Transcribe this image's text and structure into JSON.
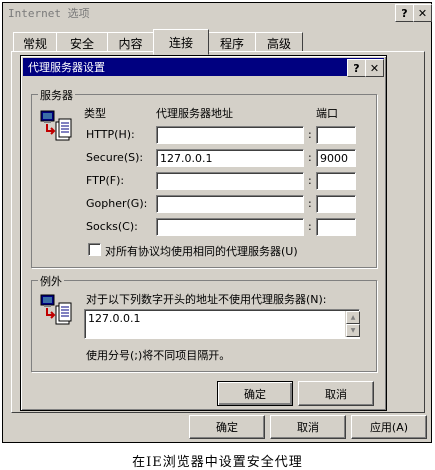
{
  "outer_window": {
    "title": "Internet 选项",
    "help_btn": "?",
    "close_btn": "✕",
    "tabs": [
      "常规",
      "安全",
      "内容",
      "连接",
      "程序",
      "高级"
    ],
    "active_tab": "连接",
    "buttons": {
      "ok": "确定",
      "cancel": "取消",
      "apply": "应用(A)"
    }
  },
  "dialog": {
    "title": "代理服务器设置",
    "help_btn": "?",
    "close_btn": "✕",
    "servers": {
      "legend": "服务器",
      "col_type": "类型",
      "col_address": "代理服务器地址",
      "col_port": "端口",
      "rows": [
        {
          "label": "HTTP(H):",
          "address": "",
          "port": ""
        },
        {
          "label": "Secure(S):",
          "address": "127.0.0.1",
          "port": "9000"
        },
        {
          "label": "FTP(F):",
          "address": "",
          "port": ""
        },
        {
          "label": "Gopher(G):",
          "address": "",
          "port": ""
        },
        {
          "label": "Socks(C):",
          "address": "",
          "port": ""
        }
      ],
      "colon": ":",
      "same_proxy_label": "对所有协议均使用相同的代理服务器(U)",
      "same_proxy_checked": false
    },
    "exceptions": {
      "legend": "例外",
      "description": "对于以下列数字开头的地址不使用代理服务器(N):",
      "value": "127.0.0.1",
      "hint": "使用分号(;)将不同项目隔开。"
    },
    "buttons": {
      "ok": "确定",
      "cancel": "取消"
    }
  },
  "caption": "在IE浏览器中设置安全代理"
}
